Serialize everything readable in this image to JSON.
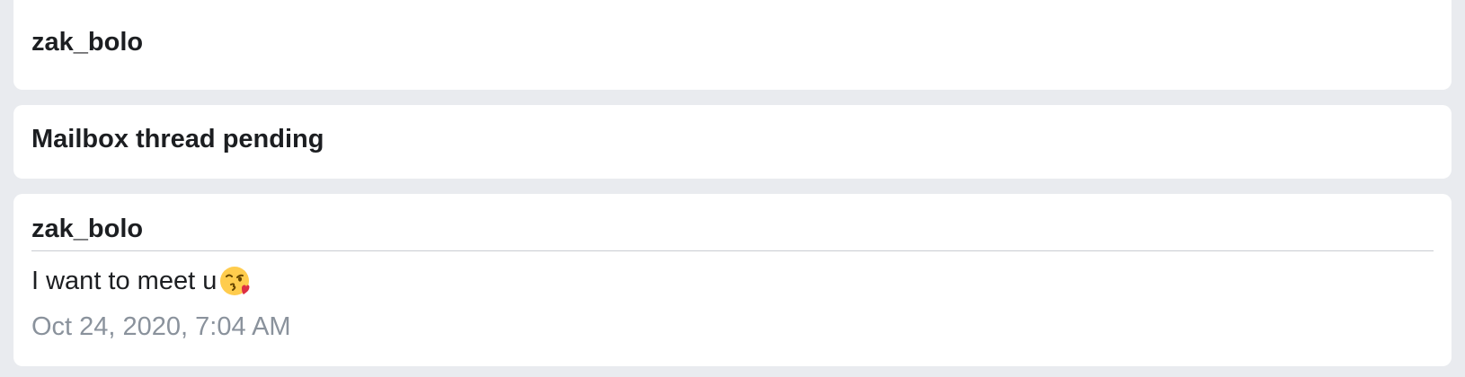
{
  "header_card": {
    "username": "zak_bolo"
  },
  "status_card": {
    "text": "Mailbox thread pending"
  },
  "message_card": {
    "sender": "zak_bolo",
    "body": "I want to meet u",
    "emoji": "face-blowing-a-kiss-icon",
    "timestamp": "Oct 24, 2020, 7:04 AM"
  },
  "colors": {
    "page_background": "#e9ebef",
    "card_background": "#ffffff",
    "primary_text": "#1c1e21",
    "secondary_text": "#8a929c",
    "divider": "#c9ccd1"
  }
}
